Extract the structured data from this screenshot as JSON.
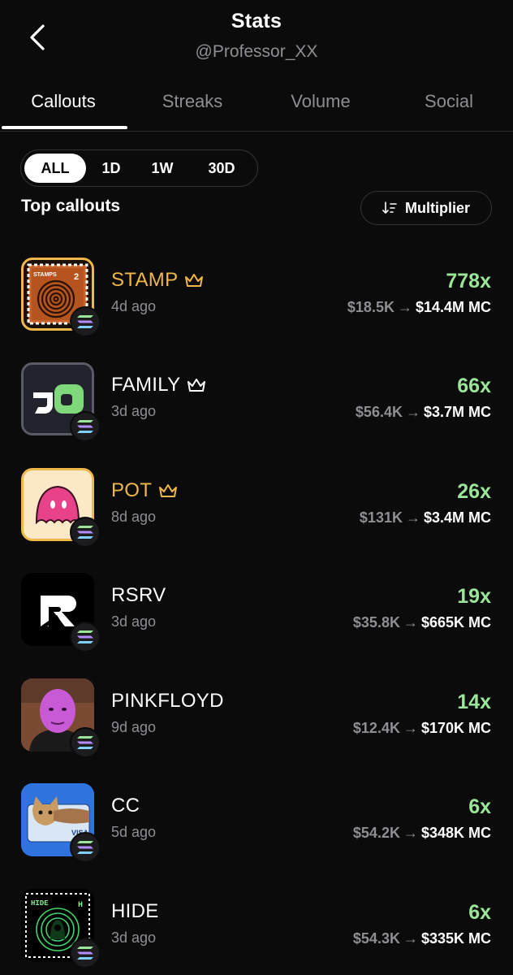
{
  "header": {
    "title": "Stats",
    "handle": "@Professor_XX"
  },
  "tabs": [
    {
      "label": "Callouts",
      "active": true
    },
    {
      "label": "Streaks",
      "active": false
    },
    {
      "label": "Volume",
      "active": false
    },
    {
      "label": "Social",
      "active": false
    }
  ],
  "filters": [
    {
      "label": "ALL",
      "active": true
    },
    {
      "label": "1D",
      "active": false
    },
    {
      "label": "1W",
      "active": false
    },
    {
      "label": "30D",
      "active": false
    }
  ],
  "section": {
    "title": "Top callouts",
    "sort_label": "Multiplier",
    "sort_icon": "sort-descending-icon"
  },
  "callouts": [
    {
      "name": "STAMP",
      "age": "4d ago",
      "multiplier": "778x",
      "from_mc": "$18.5K",
      "to_mc": "$14.4M MC",
      "crown": true,
      "name_color": "#f0b84a",
      "image": "stamp-logo",
      "chain_icon": "solana-icon"
    },
    {
      "name": "FAMILY",
      "age": "3d ago",
      "multiplier": "66x",
      "from_mc": "$56.4K",
      "to_mc": "$3.7M MC",
      "crown": true,
      "name_color": "#ffffff",
      "image": "family-logo",
      "chain_icon": "solana-icon"
    },
    {
      "name": "POT",
      "age": "8d ago",
      "multiplier": "26x",
      "from_mc": "$131K",
      "to_mc": "$3.4M MC",
      "crown": true,
      "name_color": "#f0b84a",
      "image": "pot-logo",
      "chain_icon": "solana-icon"
    },
    {
      "name": "RSRV",
      "age": "3d ago",
      "multiplier": "19x",
      "from_mc": "$35.8K",
      "to_mc": "$665K MC",
      "crown": false,
      "name_color": "#ffffff",
      "image": "rsrv-logo",
      "chain_icon": "solana-icon"
    },
    {
      "name": "PINKFLOYD",
      "age": "9d ago",
      "multiplier": "14x",
      "from_mc": "$12.4K",
      "to_mc": "$170K MC",
      "crown": false,
      "name_color": "#ffffff",
      "image": "pinkfloyd-portrait",
      "chain_icon": "solana-icon"
    },
    {
      "name": "CC",
      "age": "5d ago",
      "multiplier": "6x",
      "from_mc": "$54.2K",
      "to_mc": "$348K MC",
      "crown": false,
      "name_color": "#ffffff",
      "image": "cat-credit-card",
      "chain_icon": "solana-icon"
    },
    {
      "name": "HIDE",
      "age": "3d ago",
      "multiplier": "6x",
      "from_mc": "$54.3K",
      "to_mc": "$335K MC",
      "crown": false,
      "name_color": "#ffffff",
      "image": "hide-logo",
      "chain_icon": "solana-icon"
    }
  ],
  "colors": {
    "background": "#0b0b0c",
    "multiplier": "#9be59a",
    "muted": "#8e8e93",
    "gold": "#f0b84a"
  }
}
